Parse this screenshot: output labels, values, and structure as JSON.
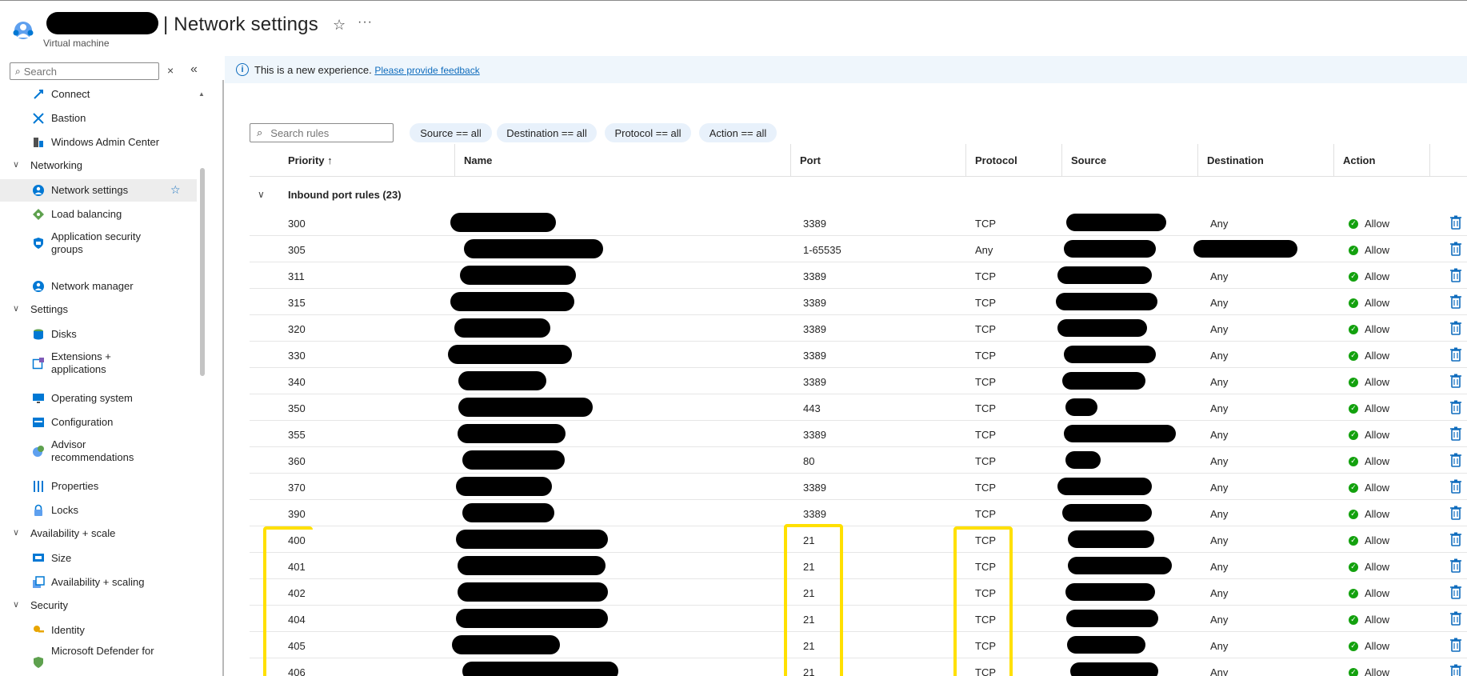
{
  "header": {
    "title": "| Network settings",
    "subtitle": "Virtual machine",
    "favorite_icon": "star-outline-icon",
    "more_label": "···"
  },
  "sidebar": {
    "search_placeholder": "Search",
    "clear_label": "×",
    "collapse_label": "«",
    "items": [
      {
        "label": "Connect",
        "icon": "connect-icon"
      },
      {
        "label": "Bastion",
        "icon": "bastion-icon"
      },
      {
        "label": "Windows Admin Center",
        "icon": "admin-center-icon"
      },
      {
        "label": "Networking",
        "group": true
      },
      {
        "label": "Network settings",
        "icon": "network-settings-icon",
        "active": true
      },
      {
        "label": "Load balancing",
        "icon": "load-balancing-icon"
      },
      {
        "label": "Application security groups",
        "icon": "asg-icon"
      },
      {
        "label": "Network manager",
        "icon": "network-manager-icon"
      },
      {
        "label": "Settings",
        "group": true
      },
      {
        "label": "Disks",
        "icon": "disks-icon"
      },
      {
        "label": "Extensions + applications",
        "icon": "extensions-icon"
      },
      {
        "label": "Operating system",
        "icon": "os-icon"
      },
      {
        "label": "Configuration",
        "icon": "configuration-icon"
      },
      {
        "label": "Advisor recommendations",
        "icon": "advisor-icon"
      },
      {
        "label": "Properties",
        "icon": "properties-icon"
      },
      {
        "label": "Locks",
        "icon": "lock-icon"
      },
      {
        "label": "Availability + scale",
        "group": true
      },
      {
        "label": "Size",
        "icon": "size-icon"
      },
      {
        "label": "Availability + scaling",
        "icon": "scaling-icon"
      },
      {
        "label": "Security",
        "group": true
      },
      {
        "label": "Identity",
        "icon": "identity-icon"
      },
      {
        "label": "Microsoft Defender for",
        "icon": "defender-icon"
      }
    ]
  },
  "banner": {
    "text": "This is a new experience.",
    "link": "Please provide feedback"
  },
  "filters": {
    "search_placeholder": "Search rules",
    "pills": [
      "Source == all",
      "Destination == all",
      "Protocol == all",
      "Action == all"
    ]
  },
  "table": {
    "columns": [
      "Priority ↑",
      "Name",
      "Port",
      "Protocol",
      "Source",
      "Destination",
      "Action"
    ],
    "group_label": "Inbound port rules (23)",
    "rows": [
      {
        "priority": "300",
        "port": "3389",
        "protocol": "TCP",
        "destination": "Any",
        "action": "Allow"
      },
      {
        "priority": "305",
        "port": "1-65535",
        "protocol": "Any",
        "destination": "",
        "action": "Allow"
      },
      {
        "priority": "311",
        "port": "3389",
        "protocol": "TCP",
        "destination": "Any",
        "action": "Allow"
      },
      {
        "priority": "315",
        "port": "3389",
        "protocol": "TCP",
        "destination": "Any",
        "action": "Allow"
      },
      {
        "priority": "320",
        "port": "3389",
        "protocol": "TCP",
        "destination": "Any",
        "action": "Allow"
      },
      {
        "priority": "330",
        "port": "3389",
        "protocol": "TCP",
        "destination": "Any",
        "action": "Allow"
      },
      {
        "priority": "340",
        "port": "3389",
        "protocol": "TCP",
        "destination": "Any",
        "action": "Allow"
      },
      {
        "priority": "350",
        "port": "443",
        "protocol": "TCP",
        "destination": "Any",
        "action": "Allow"
      },
      {
        "priority": "355",
        "port": "3389",
        "protocol": "TCP",
        "destination": "Any",
        "action": "Allow"
      },
      {
        "priority": "360",
        "port": "80",
        "protocol": "TCP",
        "destination": "Any",
        "action": "Allow"
      },
      {
        "priority": "370",
        "port": "3389",
        "protocol": "TCP",
        "destination": "Any",
        "action": "Allow"
      },
      {
        "priority": "390",
        "port": "3389",
        "protocol": "TCP",
        "destination": "Any",
        "action": "Allow"
      },
      {
        "priority": "400",
        "port": "21",
        "protocol": "TCP",
        "destination": "Any",
        "action": "Allow"
      },
      {
        "priority": "401",
        "port": "21",
        "protocol": "TCP",
        "destination": "Any",
        "action": "Allow"
      },
      {
        "priority": "402",
        "port": "21",
        "protocol": "TCP",
        "destination": "Any",
        "action": "Allow"
      },
      {
        "priority": "404",
        "port": "21",
        "protocol": "TCP",
        "destination": "Any",
        "action": "Allow"
      },
      {
        "priority": "405",
        "port": "21",
        "protocol": "TCP",
        "destination": "Any",
        "action": "Allow"
      },
      {
        "priority": "406",
        "port": "21",
        "protocol": "TCP",
        "destination": "Any",
        "action": "Allow"
      }
    ]
  },
  "colors": {
    "accent": "#0f6cbd",
    "allow": "#13a10e",
    "highlight": "#ffe000"
  }
}
